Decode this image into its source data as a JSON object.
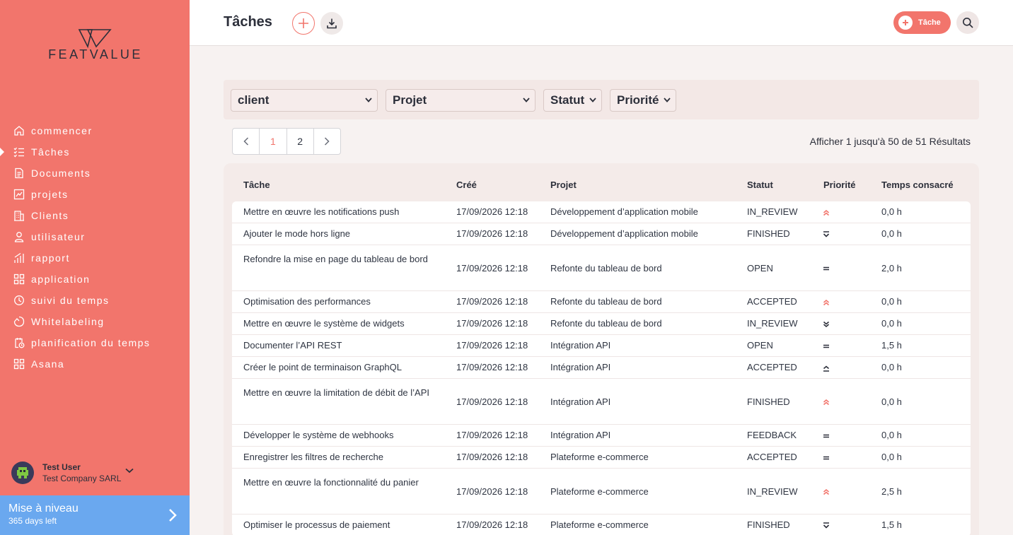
{
  "brand": {
    "name": "FEATVALUE"
  },
  "sidebar": {
    "items": [
      {
        "label": "commencer",
        "icon": "home-icon"
      },
      {
        "label": "Tâches",
        "icon": "checklist-icon",
        "active": true
      },
      {
        "label": "Documents",
        "icon": "document-icon"
      },
      {
        "label": "projets",
        "icon": "chart-icon"
      },
      {
        "label": "Clients",
        "icon": "building-icon"
      },
      {
        "label": "utilisateur",
        "icon": "user-icon"
      },
      {
        "label": "rapport",
        "icon": "bar-chart-icon"
      },
      {
        "label": "application",
        "icon": "apps-icon"
      },
      {
        "label": "suivi du temps",
        "icon": "timer-icon"
      },
      {
        "label": "Whitelabeling",
        "icon": "tag-icon"
      },
      {
        "label": "planification du temps",
        "icon": "calendar-clock-icon"
      },
      {
        "label": "Asana",
        "icon": "apps-icon"
      }
    ],
    "user": {
      "name": "Test User",
      "company": "Test Company SARL"
    },
    "upgrade": {
      "title": "Mise à niveau",
      "subtitle": "365 days left"
    }
  },
  "header": {
    "title": "Tâches",
    "new_task_label": "Tâche"
  },
  "filters": {
    "client": "client",
    "project": "Projet",
    "status": "Statut",
    "priority": "Priorité"
  },
  "pagination": {
    "pages": [
      "1",
      "2"
    ],
    "current": "1",
    "results_text": "Afficher 1 jusqu'à 50 de 51 Résultats"
  },
  "table": {
    "columns": [
      "Tâche",
      "Créé",
      "Projet",
      "Statut",
      "Priorité",
      "Temps consacré"
    ],
    "rows": [
      {
        "task": "Mettre en œuvre les notifications push",
        "created": "17/09/2026 12:18",
        "project": "Développement d’application mobile",
        "status": "IN_REVIEW",
        "priority": "highest",
        "time": "0,0 h"
      },
      {
        "task": "Ajouter le mode hors ligne",
        "created": "17/09/2026 12:18",
        "project": "Développement d’application mobile",
        "status": "FINISHED",
        "priority": "lowest-bar",
        "time": "0,0 h"
      },
      {
        "task": "Refondre la mise en page du tableau de bord",
        "created": "17/09/2026 12:18",
        "project": "Refonte du tableau de bord",
        "status": "OPEN",
        "priority": "medium",
        "time": "2,0 h"
      },
      {
        "task": "Optimisation des performances",
        "created": "17/09/2026 12:18",
        "project": "Refonte du tableau de bord",
        "status": "ACCEPTED",
        "priority": "highest",
        "time": "0,0 h"
      },
      {
        "task": "Mettre en œuvre le système de widgets",
        "created": "17/09/2026 12:18",
        "project": "Refonte du tableau de bord",
        "status": "IN_REVIEW",
        "priority": "lowest",
        "time": "0,0 h"
      },
      {
        "task": "Documenter l’API REST",
        "created": "17/09/2026 12:18",
        "project": "Intégration API",
        "status": "OPEN",
        "priority": "medium",
        "time": "1,5 h"
      },
      {
        "task": "Créer le point de terminaison GraphQL",
        "created": "17/09/2026 12:18",
        "project": "Intégration API",
        "status": "ACCEPTED",
        "priority": "high",
        "time": "0,0 h"
      },
      {
        "task": "Mettre en œuvre la limitation de débit de l’API",
        "created": "17/09/2026 12:18",
        "project": "Intégration API",
        "status": "FINISHED",
        "priority": "highest",
        "time": "0,0 h"
      },
      {
        "task": "Développer le système de webhooks",
        "created": "17/09/2026 12:18",
        "project": "Intégration API",
        "status": "FEEDBACK",
        "priority": "medium",
        "time": "0,0 h"
      },
      {
        "task": "Enregistrer les filtres de recherche",
        "created": "17/09/2026 12:18",
        "project": "Plateforme e-commerce",
        "status": "ACCEPTED",
        "priority": "medium",
        "time": "0,0 h"
      },
      {
        "task": "Mettre en œuvre la fonctionnalité du panier",
        "created": "17/09/2026 12:18",
        "project": "Plateforme e-commerce",
        "status": "IN_REVIEW",
        "priority": "highest",
        "time": "2,5 h"
      },
      {
        "task": "Optimiser le processus de paiement",
        "created": "17/09/2026 12:18",
        "project": "Plateforme e-commerce",
        "status": "FINISHED",
        "priority": "lowest-bar",
        "time": "1,5 h"
      }
    ]
  },
  "colors": {
    "accent": "#f2756c",
    "upgrade": "#6aa8ef",
    "text": "#2c2f3a"
  }
}
